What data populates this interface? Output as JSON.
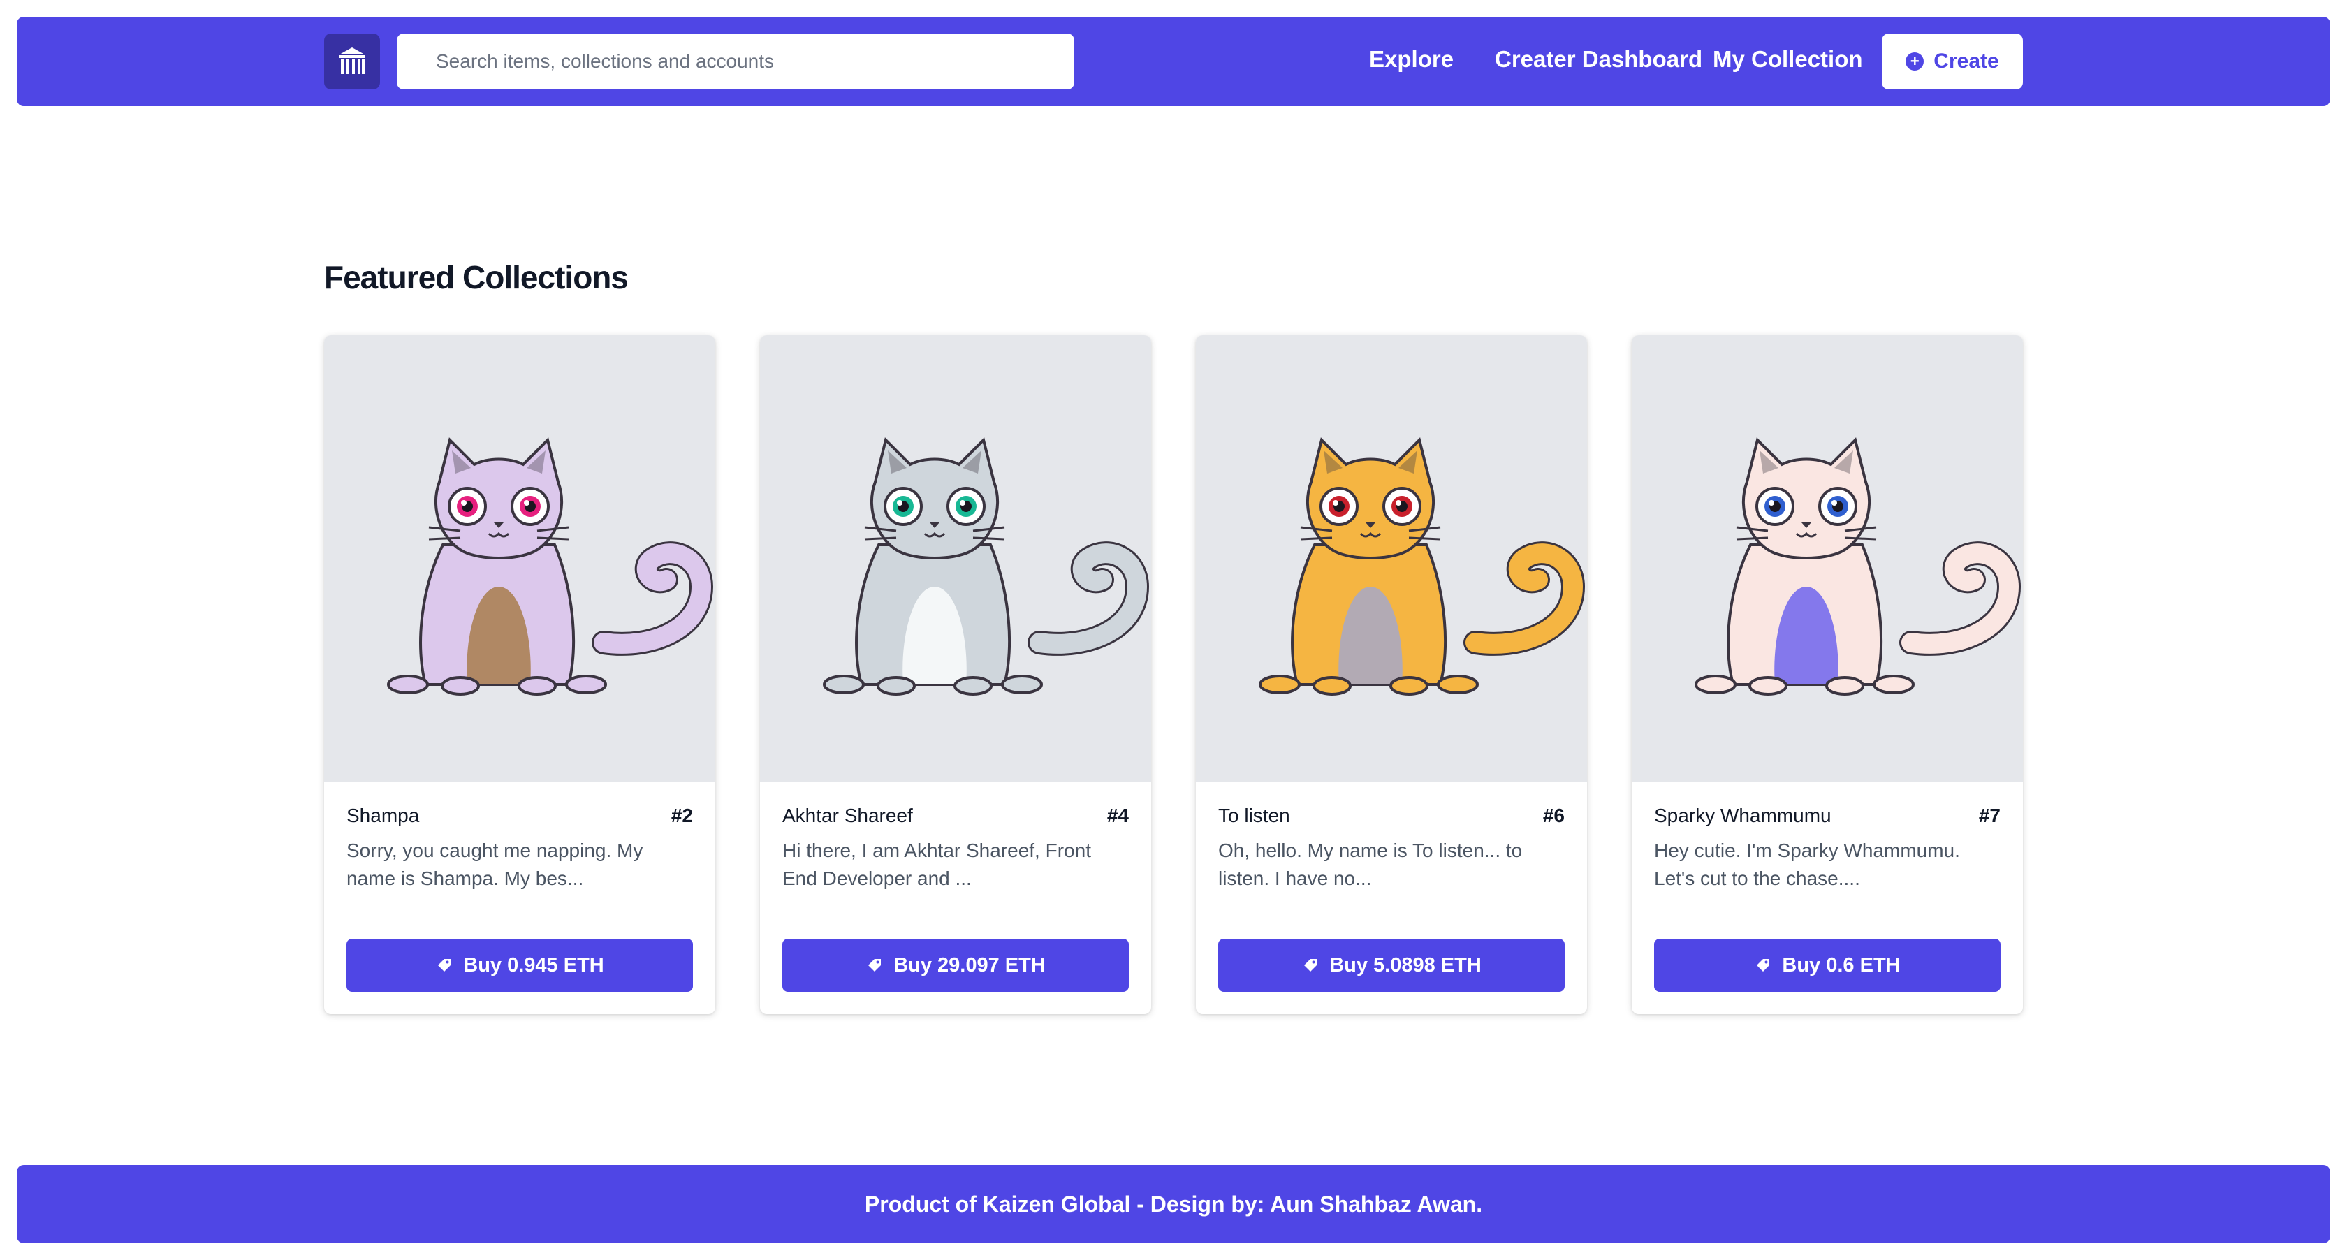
{
  "header": {
    "logo_icon": "building-logo-icon",
    "search": {
      "placeholder": "Search items, collections and accounts",
      "value": ""
    },
    "nav": [
      {
        "label": "Explore"
      },
      {
        "label": "Creater Dashboard"
      },
      {
        "label": "My Collection"
      }
    ],
    "create_button": {
      "label": "Create",
      "icon": "plus-circle-icon"
    }
  },
  "main": {
    "section_title": "Featured Collections",
    "cards": [
      {
        "name": "Shampa",
        "number": "#2",
        "description": "Sorry, you caught me napping. My name is Shampa. My bes...",
        "buy_label": "Buy 0.945 ETH",
        "image": "cat-illustration",
        "body_color": "#dcc8ec",
        "belly_color": "#b08864",
        "eye_color": "#e6207e"
      },
      {
        "name": "Akhtar Shareef",
        "number": "#4",
        "description": "Hi there, I am Akhtar Shareef, Front End Developer and ...",
        "buy_label": "Buy 29.097 ETH",
        "image": "cat-illustration",
        "body_color": "#cfd6dc",
        "belly_color": "#f4f7f8",
        "eye_color": "#18b894"
      },
      {
        "name": "To listen",
        "number": "#6",
        "description": "Oh, hello. My name is To listen... to listen. I have no...",
        "buy_label": "Buy 5.0898 ETH",
        "image": "cat-illustration",
        "body_color": "#f5b542",
        "belly_color": "#b2aab4",
        "eye_color": "#c8202c"
      },
      {
        "name": "Sparky Whammumu",
        "number": "#7",
        "description": "Hey cutie. I'm Sparky Whammumu. Let's cut to the chase....",
        "buy_label": "Buy 0.6 ETH",
        "image": "cat-illustration",
        "body_color": "#fae6e2",
        "belly_color": "#8478ec",
        "eye_color": "#2f5fcf"
      }
    ]
  },
  "footer": {
    "text": "Product of Kaizen Global - Design by: Aun Shahbaz Awan."
  }
}
